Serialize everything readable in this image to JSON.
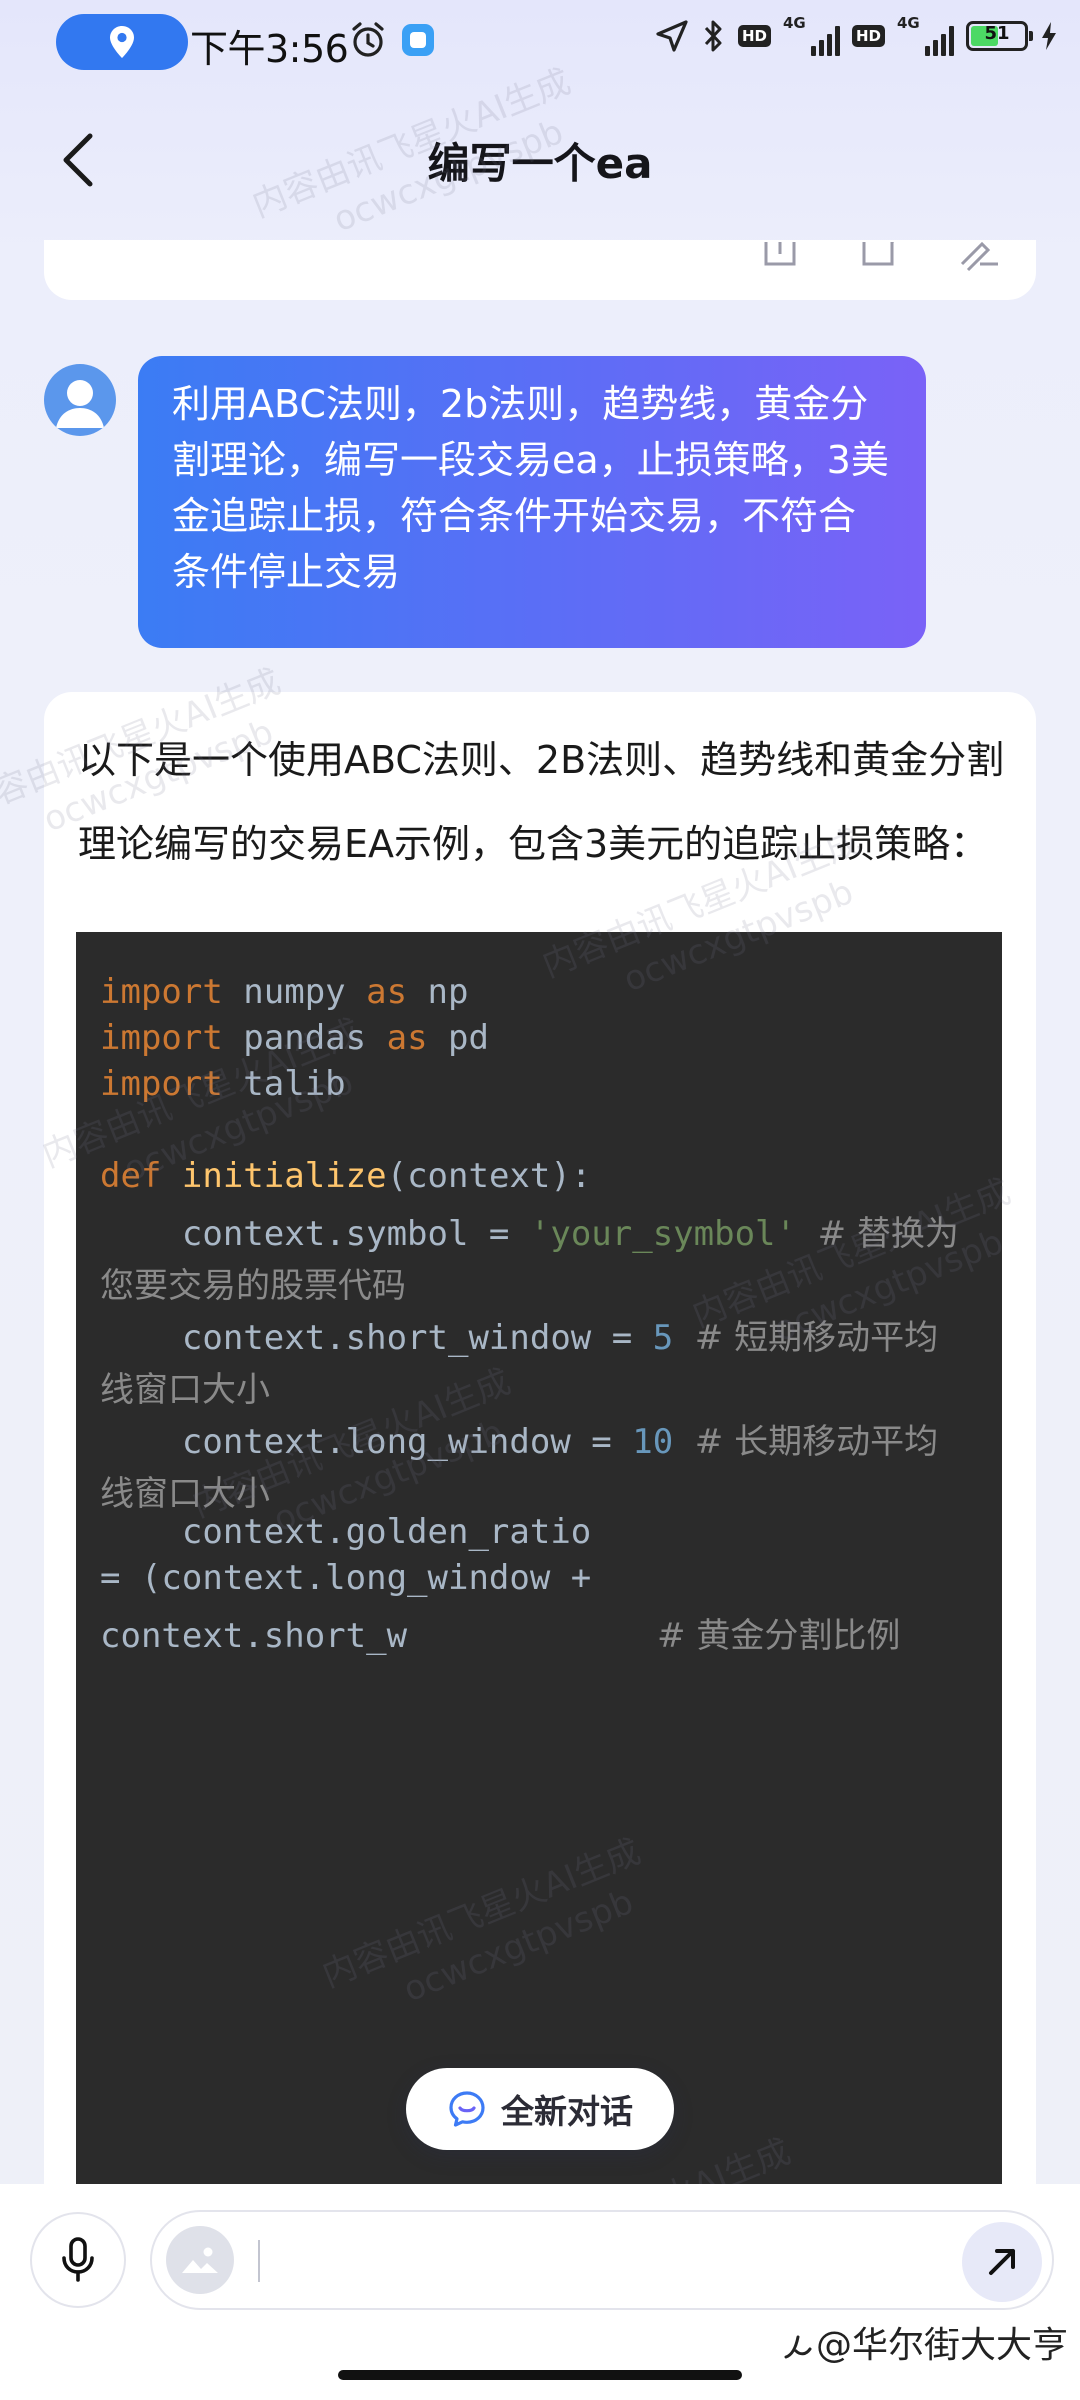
{
  "status_bar": {
    "time": "下午3:56",
    "network_label_1": "4G",
    "network_label_2": "4G",
    "hd_1": "HD",
    "hd_2": "HD",
    "battery_percent": 51,
    "battery_label": "51"
  },
  "header": {
    "title": "编写一个ea"
  },
  "messages": {
    "user_prompt": "利用ABC法则，2b法则，趋势线，黄金分割理论，编写一段交易ea，止损策略，3美金追踪止损，符合条件开始交易，不符合条件停止交易",
    "answer_intro": "以下是一个使用ABC法则、2B法则、趋势线和黄金分割理论编写的交易EA示例，包含3美元的追踪止损策略："
  },
  "code": {
    "l1": {
      "kw1": "import",
      "name": " numpy ",
      "kw2": "as",
      "alias": " np"
    },
    "l2": {
      "kw1": "import",
      "name": " pandas ",
      "kw2": "as",
      "alias": " pd"
    },
    "l3": {
      "kw1": "import",
      "name": " talib"
    },
    "l4": {
      "kw": "def",
      "fn": " initialize",
      "rest": "(context):"
    },
    "l5": {
      "pre": "    context.symbol = ",
      "str": "'your_symbol'",
      "cmt": "  # 替换为"
    },
    "l6": {
      "cmt": "您要交易的股票代码"
    },
    "l7": {
      "pre": "    context.short_window = ",
      "num": "5",
      "cmt": "  # 短期移动平均"
    },
    "l8": {
      "cmt": "线窗口大小"
    },
    "l9": {
      "pre": "    context.long_window = ",
      "num": "10",
      "cmt": "  # 长期移动平均"
    },
    "l10": {
      "cmt": "线窗口大小"
    },
    "l11": {
      "text": "    context.golden_ratio"
    },
    "l12": {
      "text": "= (context.long_window +"
    },
    "l13": {
      "pre": "context.short_w",
      "cmt": "# 黄金分割比例"
    }
  },
  "actions": {
    "new_chat_label": "全新对话"
  },
  "input": {
    "placeholder": "",
    "value": ""
  },
  "footer": {
    "source_tag": "@华尔街大大亨"
  },
  "watermarks": {
    "line1": "内容由讯飞星火AI生成",
    "line2": "ocwcxgtpvspb"
  },
  "colors": {
    "user_bubble_start": "#3b7cf4",
    "user_bubble_end": "#7a62f7",
    "code_bg": "#2b2b2b",
    "keyword": "#cc7832",
    "function": "#ffc66d",
    "string": "#6a8759",
    "number": "#6897bb",
    "location_pill": "#3278f0",
    "battery_fill": "#4cd964"
  }
}
